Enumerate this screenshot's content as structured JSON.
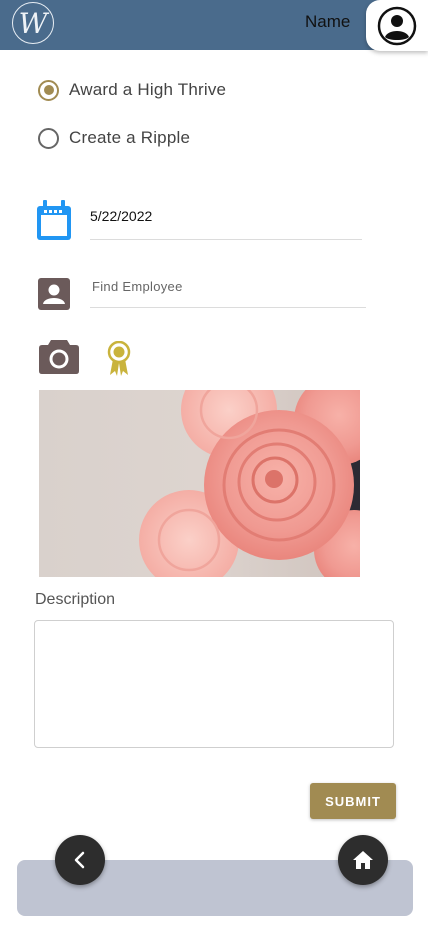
{
  "header": {
    "logo_letter": "W",
    "name_label": "Name"
  },
  "form": {
    "options": [
      {
        "label": "Award a High Thrive",
        "selected": true
      },
      {
        "label": "Create a Ripple",
        "selected": false
      }
    ],
    "date_value": "5/22/2022",
    "employee_placeholder": "Find Employee",
    "description_label": "Description",
    "submit_label": "SUBMIT"
  },
  "icons": {
    "logo": "logo-icon",
    "profile": "profile-icon",
    "calendar": "calendar-icon",
    "employee": "person-badge-icon",
    "camera": "camera-icon",
    "award": "award-ribbon-icon",
    "back": "chevron-left-icon",
    "home": "home-icon"
  },
  "colors": {
    "header": "#4a6b8c",
    "accent_gold": "#a18b52",
    "calendar_blue": "#2196f3",
    "bottom_bar": "#bfc4d2"
  }
}
